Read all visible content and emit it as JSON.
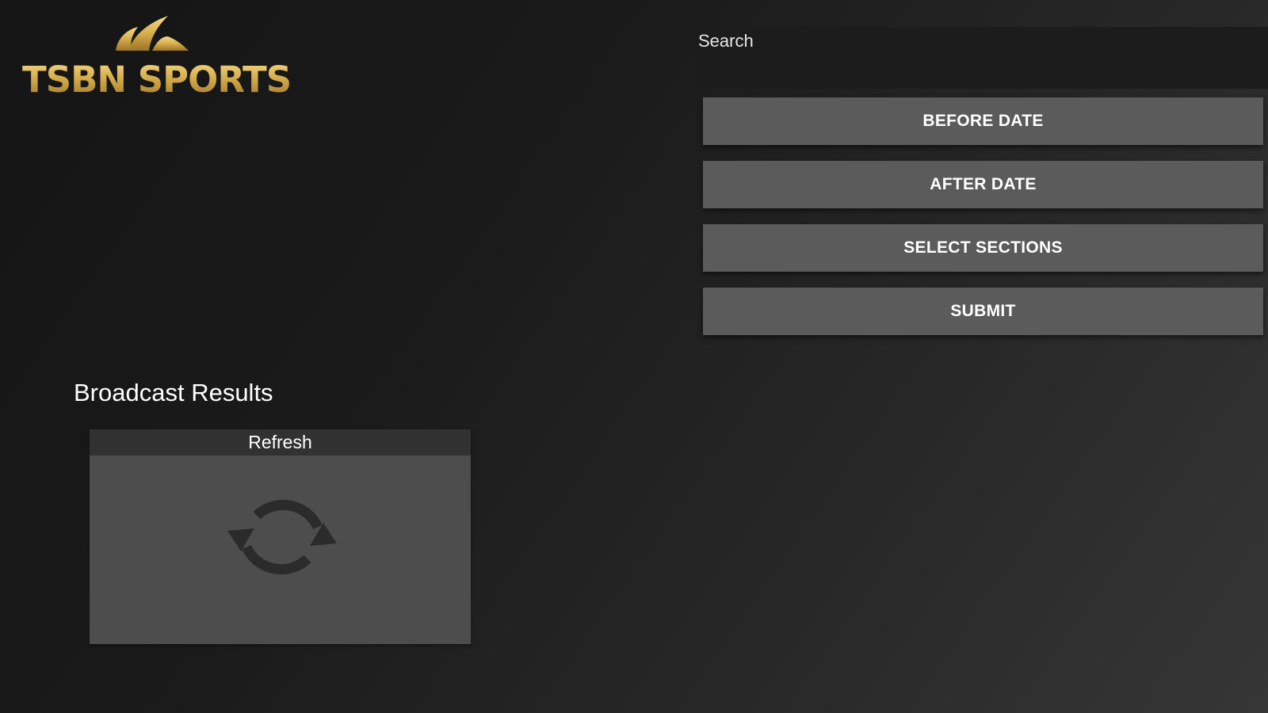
{
  "brand": {
    "name": "TSBN SPORTS"
  },
  "search": {
    "label": "Search",
    "value": ""
  },
  "filters": {
    "before_date": "BEFORE DATE",
    "after_date": "AFTER DATE",
    "select_sections": "SELECT SECTIONS",
    "submit": "SUBMIT"
  },
  "results": {
    "title": "Broadcast Results",
    "items": [
      {
        "label": "Refresh",
        "icon": "refresh-icon"
      }
    ]
  },
  "colors": {
    "brand_gold": "#d6ae4c",
    "button_bg": "#5b5b5b",
    "card_bg": "#4d4d4d",
    "card_header_bg": "#313131",
    "icon_color": "#2b2b2b"
  }
}
